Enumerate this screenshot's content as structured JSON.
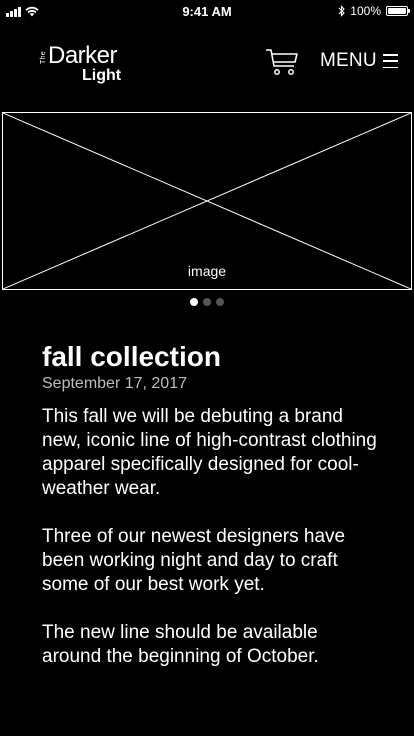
{
  "status_bar": {
    "time": "9:41 AM",
    "battery_text": "100%",
    "battery_level": 1.0
  },
  "header": {
    "logo": {
      "the": "The",
      "darker": "Darker",
      "light": "Light"
    },
    "cart_icon": "cart-icon",
    "menu_label": "MENU",
    "menu_icon": "hamburger-icon"
  },
  "hero": {
    "label": "image"
  },
  "carousel": {
    "count": 3,
    "active_index": 0
  },
  "article": {
    "title": "fall collection",
    "date": "September 17, 2017",
    "paragraphs": [
      "This fall we will be debuting a brand new, iconic line of high-contrast clothing apparel specifically designed for cool-weather wear.",
      "Three of our newest designers have been working night and day to craft some of our best work yet.",
      "The new line should be available around the beginning of October."
    ]
  },
  "colors": {
    "background": "#000000",
    "text": "#ffffff",
    "muted_text": "#bdbdbd",
    "dot_inactive": "#555555"
  }
}
